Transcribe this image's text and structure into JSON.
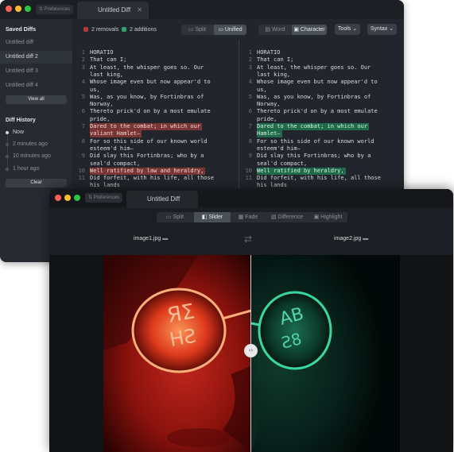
{
  "window_text_diff": {
    "preferences_label": "⇅ Preferences",
    "tab_title": "Untitled Diff",
    "tab_close": "✕",
    "sidebar": {
      "saved_heading": "Saved Diffs",
      "saved_items": [
        "Untitled diff",
        "Untitled diff 2",
        "Untitled diff 3",
        "Untitled diff 4"
      ],
      "view_all": "View all",
      "history_heading": "Diff History",
      "history_items": [
        "Now",
        "2 minutes ago",
        "10 minutes ago",
        "1 hour ago"
      ],
      "clear": "Clear"
    },
    "toolbar": {
      "removals": "2 removals",
      "additions": "2 additions",
      "view_modes": [
        "Split",
        "Unified"
      ],
      "granularity": [
        "Word",
        "Character"
      ],
      "tools": "Tools ⌄",
      "syntax": "Syntax ⌄"
    },
    "left_lines": [
      {
        "n": "1",
        "t": "HORATIO"
      },
      {
        "n": "2",
        "t": "That can I;"
      },
      {
        "n": "3",
        "t": "At least, the whisper goes so. Our"
      },
      {
        "n": "",
        "t": "last king,"
      },
      {
        "n": "4",
        "t": "Whose image even but now appear'd to"
      },
      {
        "n": "",
        "t": "us,"
      },
      {
        "n": "5",
        "t": "Was, as you know, by Fortinbras of"
      },
      {
        "n": "",
        "t": "Norway,"
      },
      {
        "n": "6",
        "t": "Thereto prick'd on by a most emulate"
      },
      {
        "n": "",
        "t": "pride,"
      },
      {
        "n": "7",
        "t": "Dared to the combat; in which our"
      },
      {
        "n": "",
        "t": "valiant Hamlet—"
      },
      {
        "n": "8",
        "t": "For so this side of our known world"
      },
      {
        "n": "",
        "t": "esteem'd him—"
      },
      {
        "n": "9",
        "t": "Did slay this Fortinbras; who by a"
      },
      {
        "n": "",
        "t": "seal'd compact,"
      },
      {
        "n": "10",
        "t": "Well ratified by law and heraldry,"
      },
      {
        "n": "11",
        "t": "Did forfeit, with his life, all those"
      },
      {
        "n": "",
        "t": "his lands"
      }
    ],
    "right_lines": [
      {
        "n": "1",
        "t": "HORATIO"
      },
      {
        "n": "2",
        "t": "That can I;"
      },
      {
        "n": "3",
        "t": "At least, the whisper goes so. Our"
      },
      {
        "n": "",
        "t": "last king,"
      },
      {
        "n": "4",
        "t": "Whose image even but now appear'd to"
      },
      {
        "n": "",
        "t": "us,"
      },
      {
        "n": "5",
        "t": "Was, as you know, by Fortinbras of"
      },
      {
        "n": "",
        "t": "Norway,"
      },
      {
        "n": "6",
        "t": "Thereto prick'd on by a most emulate"
      },
      {
        "n": "",
        "t": "pride,"
      },
      {
        "n": "7",
        "t": "Dared to the combat; in which our"
      },
      {
        "n": "",
        "t": "Hamlet—"
      },
      {
        "n": "8",
        "t": "For so this side of our known world"
      },
      {
        "n": "",
        "t": "esteem'd him—"
      },
      {
        "n": "9",
        "t": "Did slay this Fortinbras; who by a"
      },
      {
        "n": "",
        "t": "seal'd compact,"
      },
      {
        "n": "10",
        "t": "Well ratified by heraldry,"
      },
      {
        "n": "11",
        "t": "Did forfeit, with his life, all those"
      },
      {
        "n": "",
        "t": "his lands"
      }
    ],
    "colors": {
      "removal": "#b23b37",
      "addition": "#2fa36b"
    }
  },
  "window_image_diff": {
    "preferences_label": "⇅ Preferences",
    "tab_title": "Untitled Diff",
    "modes": [
      "Split",
      "Slider",
      "Fade",
      "Difference",
      "Highlight"
    ],
    "selected_mode": "Slider",
    "left_file": "image1.jpg",
    "right_file": "image2.jpg",
    "swap_icon": "⇄",
    "slider_knob": "‹›"
  }
}
